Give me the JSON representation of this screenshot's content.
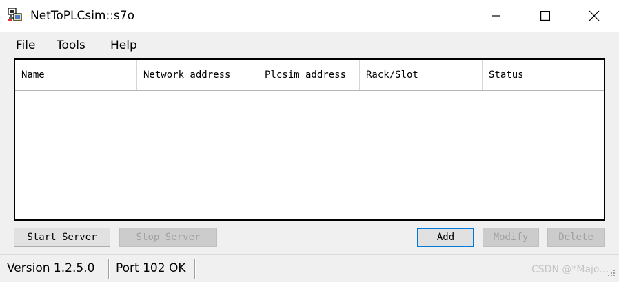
{
  "window": {
    "title": "NetToPLCsim::s7o"
  },
  "titlebar_controls": {
    "minimize_icon": "minimize-icon",
    "maximize_icon": "maximize-icon",
    "close_icon": "close-icon"
  },
  "menu": {
    "items": [
      {
        "label": "File"
      },
      {
        "label": "Tools"
      },
      {
        "label": "Help"
      }
    ]
  },
  "table": {
    "columns": [
      {
        "label": "Name"
      },
      {
        "label": "Network address"
      },
      {
        "label": "Plcsim address"
      },
      {
        "label": "Rack/Slot"
      },
      {
        "label": "Status"
      }
    ],
    "rows": []
  },
  "buttons": {
    "start_server": "Start Server",
    "stop_server": "Stop Server",
    "add": "Add",
    "modify": "Modify",
    "delete": "Delete"
  },
  "status": {
    "version": "Version 1.2.5.0",
    "port": "Port 102 OK"
  },
  "watermark": "CSDN @*Majo…",
  "colors": {
    "accent": "#0078d7",
    "window_bg": "#f0f0f0",
    "titlebar_bg": "#ffffff"
  }
}
